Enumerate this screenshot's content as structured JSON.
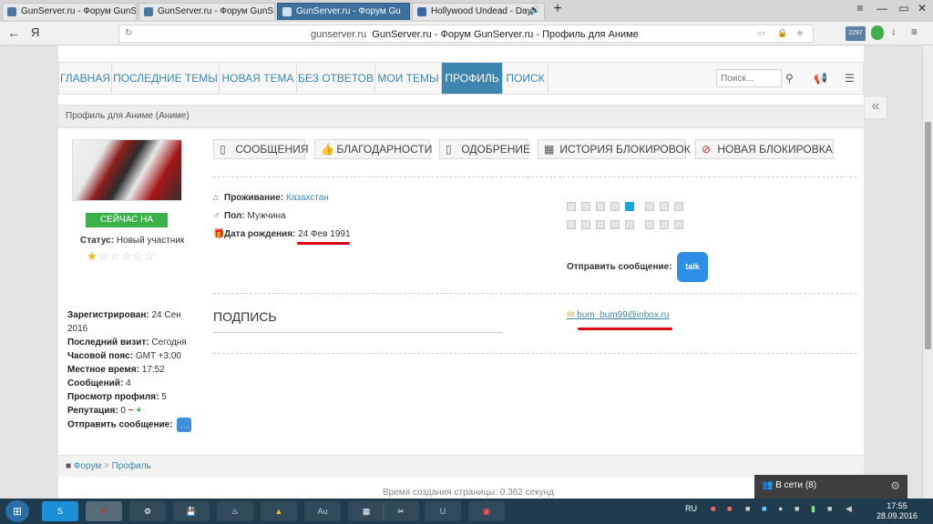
{
  "browser": {
    "tabs": [
      {
        "label": "GunServer.ru - Форум GunS",
        "active": false
      },
      {
        "label": "GunServer.ru - Форум GunS",
        "active": false
      },
      {
        "label": "GunServer.ru - Форум Gu",
        "active": true
      },
      {
        "label": "Hollywood Undead - Day",
        "active": false
      }
    ],
    "new_tab": "+",
    "window_controls": {
      "menu": "≡",
      "minimize": "—",
      "restore": "▭",
      "close": "✕"
    },
    "back": "←",
    "yandex": "Я",
    "reload": "↻",
    "url_domain": "gunserver.ru",
    "url_title": "GunServer.ru - Форум GunServer.ru - Профиль для Аниме",
    "badge_count": "2297",
    "right_icons": {
      "bookmark": "★",
      "lock": "🔒",
      "download": "↓",
      "menu": "≡"
    }
  },
  "nav": {
    "items": [
      "ГЛАВНАЯ",
      "ПОСЛЕДНИЕ ТЕМЫ",
      "НОВАЯ ТЕМА",
      "БЕЗ ОТВЕТОВ",
      "МОИ ТЕМЫ",
      "ПРОФИЛЬ",
      "ПОИСК"
    ],
    "search_placeholder": "Поиск..."
  },
  "page_title": "Профиль для Аниме (Аниме)",
  "side": {
    "online_badge": "СЕЙЧАС НА САЙТЕ",
    "status_label": "Статус:",
    "status_value": "Новый участник",
    "stars_filled": 1,
    "stars_total": 6,
    "stats": [
      {
        "label": "Зарегистрирован:",
        "value": "24 Сен 2016"
      },
      {
        "label": "Последний визит:",
        "value": "Сегодня"
      },
      {
        "label": "Часовой пояс:",
        "value": "GMT +3:00"
      },
      {
        "label": "Местное время:",
        "value": "17:52"
      },
      {
        "label": "Сообщений:",
        "value": "4"
      },
      {
        "label": "Просмотр профиля:",
        "value": "5"
      }
    ],
    "reputation_label": "Репутация:",
    "reputation_value": "0",
    "send_message_label": "Отправить сообщение:"
  },
  "buttons": [
    "СООБЩЕНИЯ",
    "БЛАГОДАРНОСТИ",
    "ОДОБРЕНИЕ",
    "ИСТОРИЯ БЛОКИРОВОК",
    "НОВАЯ БЛОКИРОВКА"
  ],
  "info": {
    "residence_label": "Проживание:",
    "residence_value": "Казахстан",
    "gender_label": "Пол:",
    "gender_value": "Мужчина",
    "birthday_label": "Дата рождения:",
    "birthday_value": "24 Фев 1991",
    "send_message_label": "Отправить сообщение:",
    "talk_label": "talk"
  },
  "signature_heading": "ПОДПИСЬ",
  "email": "bum_bum99@inbox.ru",
  "breadcrumb": {
    "home": "Форум",
    "sep": ">",
    "current": "Профиль"
  },
  "footer_note": "Время создания страницы: 0.362 секунд",
  "online_panel": "В сети (8)",
  "taskbar": {
    "lang": "RU",
    "time": "17:55",
    "date": "28.09.2016",
    "apps": [
      "S",
      "Y",
      "⚙",
      "💾",
      "♨",
      "▲",
      "Au",
      "▦",
      "✂",
      "U",
      "▣"
    ]
  },
  "colors": {
    "accent": "#3f86ae",
    "online": "#3bb14a",
    "highlight": "#e00012"
  }
}
